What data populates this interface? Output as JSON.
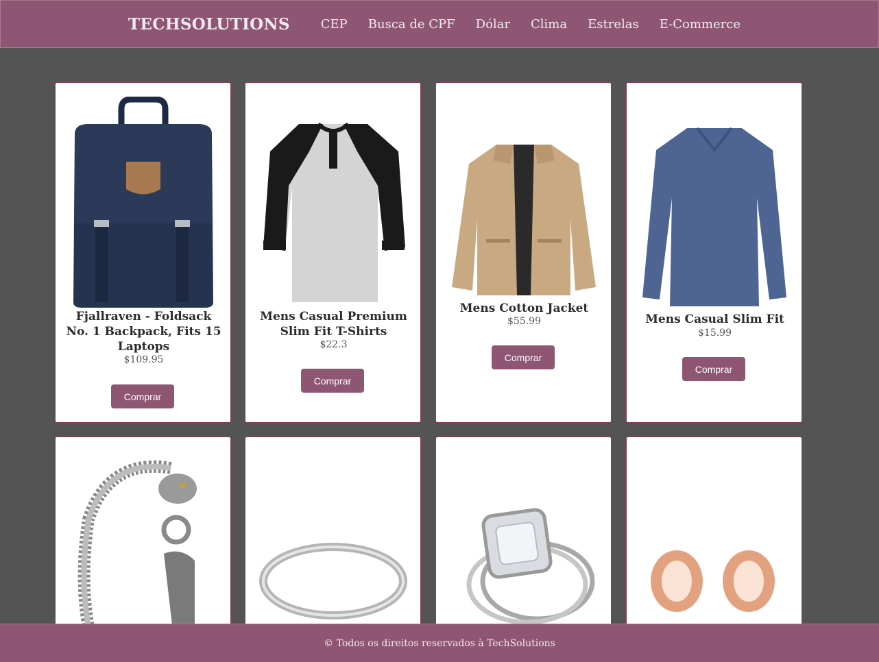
{
  "navbar": {
    "brand": "TECHSOLUTIONS",
    "links": [
      "CEP",
      "Busca de CPF",
      "Dólar",
      "Clima",
      "Estrelas",
      "E-Commerce"
    ]
  },
  "products": [
    {
      "title": "Fjallraven - Foldsack No. 1 Backpack, Fits 15 Laptops",
      "price": "$109.95",
      "button": "Comprar",
      "image": "backpack-image"
    },
    {
      "title": "Mens Casual Premium Slim Fit T-Shirts",
      "price": "$22.3",
      "button": "Comprar",
      "image": "raglan-shirt-image"
    },
    {
      "title": "Mens Cotton Jacket",
      "price": "$55.99",
      "button": "Comprar",
      "image": "cotton-jacket-image"
    },
    {
      "title": "Mens Casual Slim Fit",
      "price": "$15.99",
      "button": "Comprar",
      "image": "long-sleeve-shirt-image"
    },
    {
      "image": "dragon-bracelet-image"
    },
    {
      "image": "silver-ring-image"
    },
    {
      "image": "diamond-ring-image"
    },
    {
      "image": "rose-gold-plugs-image"
    }
  ],
  "footer": {
    "text": "© Todos os direitos reservados à TechSolutions"
  },
  "colors": {
    "accent": "#8e5672",
    "background": "#545454",
    "card": "#ffffff",
    "card_border": "#8e3a5a"
  }
}
